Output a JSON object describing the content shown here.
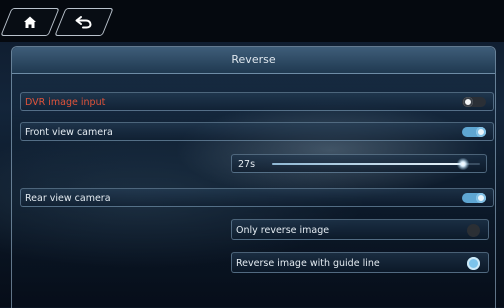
{
  "header": {
    "home_icon": "home-icon",
    "back_icon": "back-arrow-icon"
  },
  "panel": {
    "title": "Reverse"
  },
  "settings": {
    "dvr": {
      "label": "DVR image input",
      "enabled": false,
      "label_color": "#e0533a"
    },
    "front": {
      "label": "Front view camera",
      "enabled": true
    },
    "delay": {
      "value_label": "27s",
      "level": 0.92
    },
    "rear": {
      "label": "Rear view camera",
      "enabled": true
    },
    "only_reverse": {
      "label": "Only reverse image",
      "selected": false
    },
    "guide_line": {
      "label": "Reverse image with guide line",
      "selected": true
    }
  },
  "colors": {
    "accent": "#5ea6d2",
    "warning_text": "#e0533a"
  }
}
